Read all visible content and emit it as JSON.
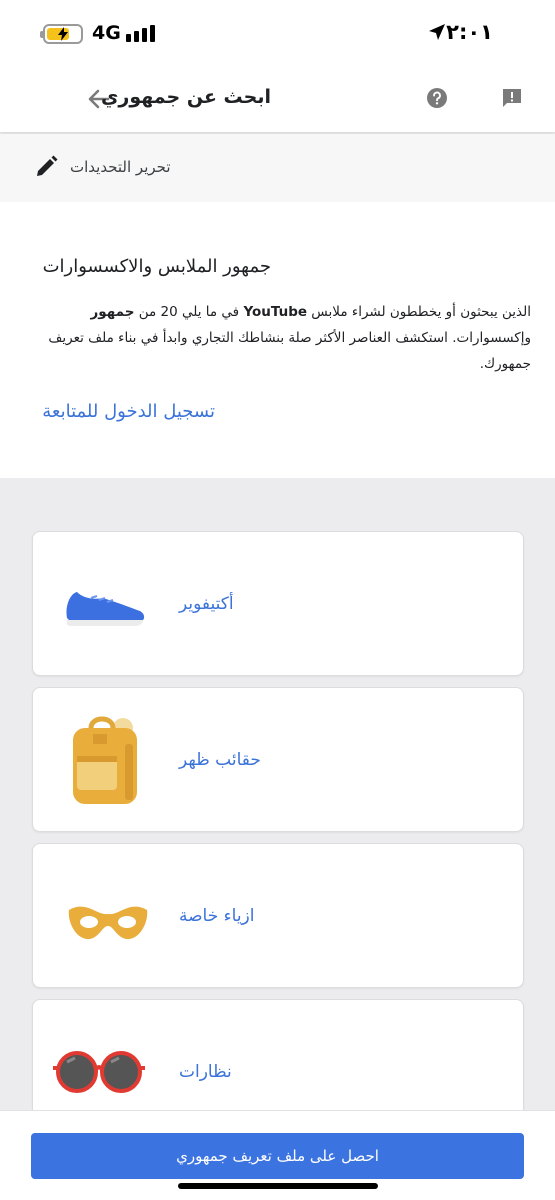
{
  "status_bar": {
    "time": "٢:٠١",
    "network": "4G"
  },
  "header": {
    "title": "ابحث عن جمهوري",
    "back_icon": "arrow-left-icon",
    "help_icon": "help-circle-icon",
    "feedback_icon": "feedback-icon"
  },
  "edit_bar": {
    "label": "تحرير التحديدات",
    "icon": "pencil-icon"
  },
  "info": {
    "title": "جمهور الملابس والاكسسوارات",
    "desc_1": "الذين يبحثون أو يخططون لشراء ملابس ",
    "desc_youtube": "YouTube",
    "desc_2": " في ما يلي 20 من ",
    "desc_bold": "جمهور",
    "desc_3": " وإكسسوارات. استكشف العناصر الأكثر صلة بنشاطك التجاري وابدأ في بناء ملف تعريف جمهورك.",
    "signin_link": "تسجيل الدخول للمتابعة"
  },
  "cards": [
    {
      "label": "أكتيفوير",
      "icon": "sneaker-icon"
    },
    {
      "label": "حقائب ظهر",
      "icon": "backpack-icon"
    },
    {
      "label": "ازياء خاصة",
      "icon": "eye-mask-icon"
    },
    {
      "label": "نظارات",
      "icon": "sunglasses-icon"
    }
  ],
  "cta": {
    "label": "احصل على ملف تعريف جمهوري"
  },
  "colors": {
    "accent": "#3b73e0",
    "link": "#3b73d9",
    "battery": "#f5c21b",
    "page_bg": "#ececef"
  }
}
